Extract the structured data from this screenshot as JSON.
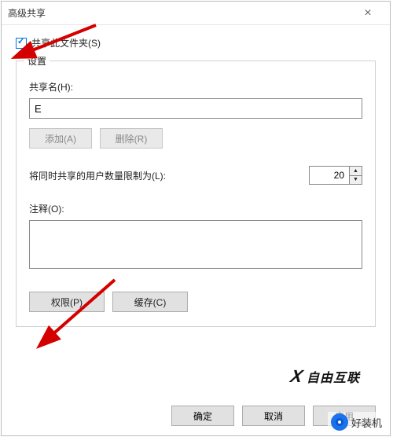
{
  "window": {
    "title": "高级共享"
  },
  "share_checkbox": {
    "label": "共享此文件夹(S)",
    "checked": true
  },
  "settings": {
    "legend": "设置",
    "share_name_label": "共享名(H):",
    "share_name_value": "E",
    "add_btn": "添加(A)",
    "remove_btn": "删除(R)",
    "limit_label": "将同时共享的用户数量限制为(L):",
    "limit_value": "20",
    "comments_label": "注释(O):",
    "comments_value": "",
    "perm_btn": "权限(P)",
    "cache_btn": "缓存(C)"
  },
  "footer": {
    "ok": "确定",
    "cancel": "取消",
    "apply": "应用"
  },
  "watermark1": "自由互联",
  "watermark2": "好装机"
}
